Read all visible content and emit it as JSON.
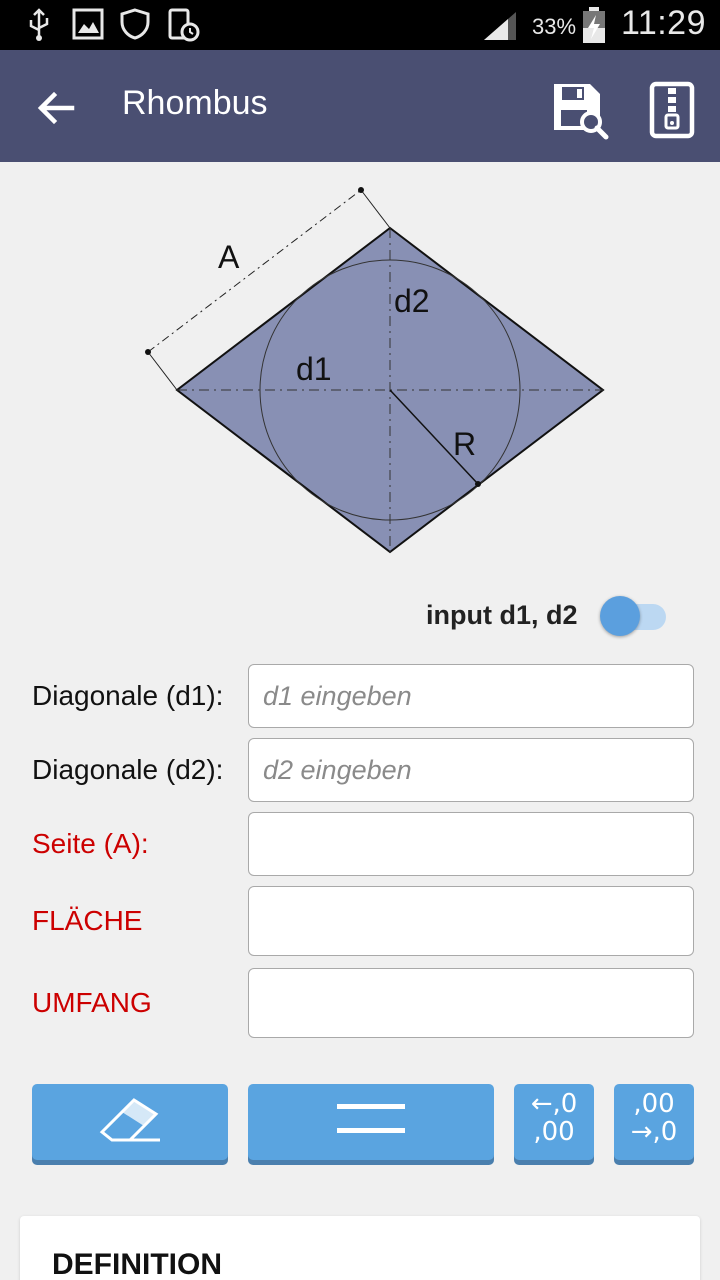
{
  "status_bar": {
    "battery": "33%",
    "time": "11:29",
    "icons": [
      "usb-icon",
      "image-icon",
      "shield-icon",
      "phone-clock-icon",
      "signal-icon",
      "battery-charging-icon"
    ]
  },
  "app_bar": {
    "title": "Rhombus",
    "back_icon": "arrow-left-icon",
    "save_icon": "save-search-icon",
    "zip_icon": "zip-file-icon"
  },
  "diagram": {
    "labels": {
      "side": "A",
      "diagonal1": "d1",
      "diagonal2": "d2",
      "radius": "R"
    },
    "fill_color": "#8890b4"
  },
  "toggle": {
    "label": "input d1, d2",
    "on": true
  },
  "form": {
    "rows": [
      {
        "label": "Diagonale (d1):",
        "placeholder": "d1 eingeben",
        "value": ""
      },
      {
        "label": "Diagonale (d2):",
        "placeholder": "d2 eingeben",
        "value": ""
      },
      {
        "label": "Seite (A):",
        "placeholder": "",
        "value": ""
      },
      {
        "label": "FLÄCHE",
        "placeholder": "",
        "value": ""
      },
      {
        "label": "UMFANG",
        "placeholder": "",
        "value": ""
      }
    ]
  },
  "buttons": {
    "clear_icon": "eraser-icon",
    "equals_icon": "equals-icon",
    "decrease_decimals": {
      "line1": "←,0",
      "line2": ",00"
    },
    "increase_decimals": {
      "line1": ",00",
      "line2": "→,0"
    }
  },
  "definition": {
    "title": "DEFINITION"
  },
  "colors": {
    "app_bar": "#4a4f72",
    "accent": "#5aa4e0",
    "required_label": "#cc0000"
  }
}
